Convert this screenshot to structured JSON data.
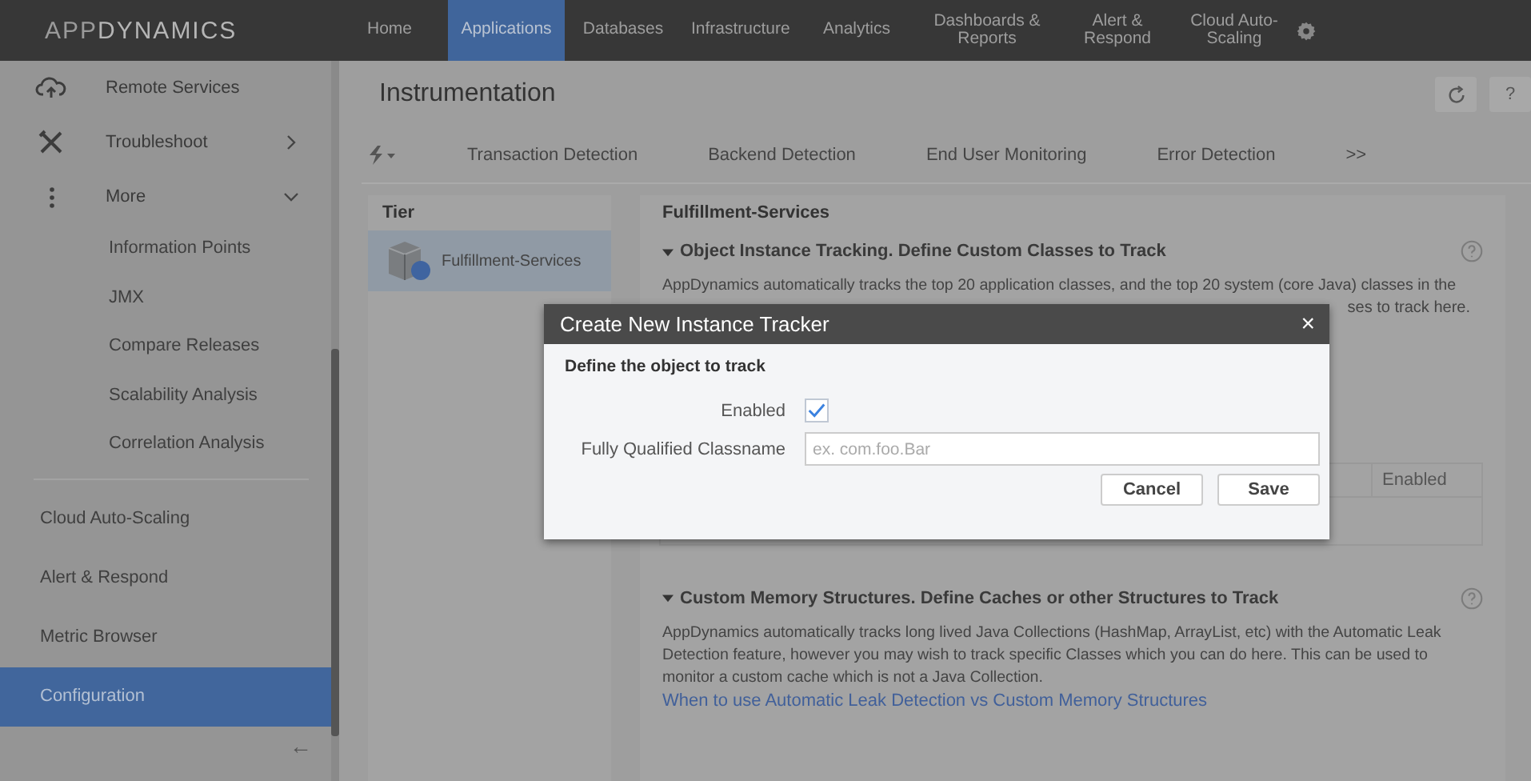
{
  "nav": {
    "logo_light": "APP",
    "logo_bold": "DYNAMICS",
    "items": [
      {
        "label": "Home",
        "selected": false
      },
      {
        "label": "Applications",
        "selected": true
      },
      {
        "label": "Databases",
        "selected": false
      },
      {
        "label": "Infrastructure",
        "selected": false
      },
      {
        "label": "Analytics",
        "selected": false
      },
      {
        "label": "Dashboards & Reports",
        "selected": false
      },
      {
        "label": "Alert & Respond",
        "selected": false
      },
      {
        "label": "Cloud Auto-Scaling",
        "selected": false
      }
    ]
  },
  "sidebar": {
    "items": [
      {
        "label": "Remote Services"
      },
      {
        "label": "Troubleshoot",
        "expanded": false
      },
      {
        "label": "More",
        "expanded": true,
        "children": [
          {
            "label": "Information Points"
          },
          {
            "label": "JMX"
          },
          {
            "label": "Compare Releases"
          },
          {
            "label": "Scalability Analysis"
          },
          {
            "label": "Correlation Analysis"
          }
        ]
      }
    ],
    "bottom_items": [
      {
        "label": "Cloud Auto-Scaling",
        "selected": false
      },
      {
        "label": "Alert & Respond",
        "selected": false
      },
      {
        "label": "Metric Browser",
        "selected": false
      },
      {
        "label": "Configuration",
        "selected": true
      }
    ],
    "collapse": "←"
  },
  "page": {
    "title": "Instrumentation",
    "help": "?",
    "tabs": [
      {
        "label": "Transaction Detection",
        "selected": false
      },
      {
        "label": "Backend Detection",
        "selected": false
      },
      {
        "label": "End User Monitoring",
        "selected": false
      },
      {
        "label": "Error Detection",
        "selected": false
      },
      {
        "label": ">>",
        "selected": false
      }
    ],
    "tier": {
      "heading": "Tier",
      "items": [
        {
          "label": "Fulfillment-Services",
          "selected": true
        }
      ]
    },
    "detail": {
      "heading": "Fulfillment-Services",
      "sections": [
        {
          "title": "Object Instance Tracking.  Define Custom Classes to Track",
          "expanded": true,
          "text": "AppDynamics automatically tracks the top 20 application classes, and the top 20 system (core Java) classes in the",
          "text_tail": "ses to track here.",
          "table_column": "Enabled"
        },
        {
          "title": "Custom Memory Structures. Define Caches or other Structures to Track",
          "expanded": true,
          "text": "AppDynamics automatically tracks long lived Java Collections (HashMap, ArrayList, etc) with the Automatic Leak Detection feature, however you may wish to track specific Classes which you can do here.  This can be used to monitor a custom cache which is not a Java Collection.",
          "link": "When to use Automatic Leak Detection vs Custom Memory Structures"
        }
      ]
    }
  },
  "dialog": {
    "title": "Create New Instance Tracker",
    "close": "×",
    "subtitle": "Define the object to track",
    "enabled": {
      "label": "Enabled",
      "checked": true
    },
    "classname": {
      "label": "Fully Qualified Classname",
      "placeholder": "ex. com.foo.Bar"
    },
    "buttons": [
      "Cancel",
      "Save"
    ]
  }
}
